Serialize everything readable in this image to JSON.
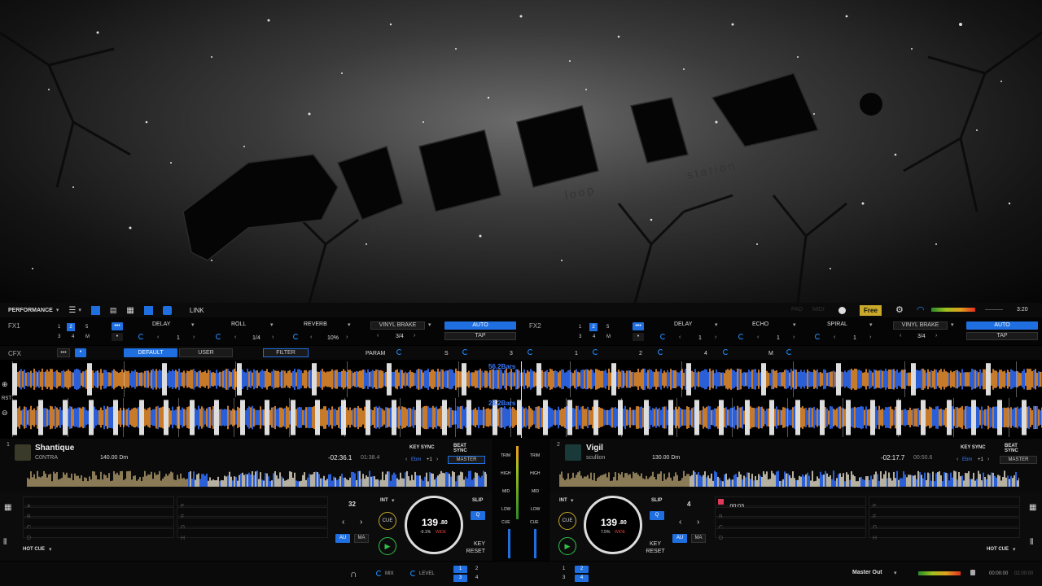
{
  "colors": {
    "accent": "#1f6fe0",
    "wave_blue": "#2b5fd8",
    "wave_orange": "#c77a2a",
    "free_badge": "#caa92a"
  },
  "banner": {
    "logo_word": "AUSY",
    "logo_sub": "Beatbox loop station"
  },
  "topbar": {
    "mode": "PERFORMANCE",
    "link": "LINK",
    "pad": "PAD",
    "midi": "MIDI",
    "free": "Free",
    "time": "3:20"
  },
  "fx1": {
    "label": "FX1",
    "pages": [
      "1",
      "2",
      "5",
      "3",
      "4",
      "M"
    ],
    "slots": [
      {
        "name": "DELAY",
        "value": "1"
      },
      {
        "name": "ROLL",
        "value": "1/4"
      },
      {
        "name": "REVERB",
        "value": "10%"
      }
    ],
    "vinyl_brake": "VINYL BRAKE",
    "vb_value": "3/4",
    "auto": "AUTO",
    "tap": "TAP"
  },
  "fx2": {
    "label": "FX2",
    "pages": [
      "1",
      "2",
      "5",
      "3",
      "4",
      "M"
    ],
    "slots": [
      {
        "name": "DELAY",
        "value": "1"
      },
      {
        "name": "ECHO",
        "value": "1"
      },
      {
        "name": "SPIRAL",
        "value": "1"
      }
    ],
    "vinyl_brake": "VINYL BRAKE",
    "vb_value": "3/4",
    "auto": "AUTO",
    "tap": "TAP"
  },
  "cfx": {
    "label": "CFX",
    "default": "DEFAULT",
    "user": "USER",
    "filter": "FILTER",
    "param": "PARAM",
    "s": "S",
    "n3": "3",
    "n1": "1",
    "n2": "2",
    "n4": "4",
    "m": "M"
  },
  "waveform": {
    "top_bars": "56.2Bars",
    "bottom_bars": "28.2Bars",
    "rst": "RST"
  },
  "deck1": {
    "num": "1",
    "title": "Shantique",
    "artist": "C0NTRA",
    "bpm_key": "140.00 Dm",
    "remain": "-02:36.1",
    "elapsed": "01:38.4",
    "key_sync": "KEY SYNC",
    "beat_sync": "BEAT SYNC",
    "key": "Ebm",
    "key_shift": "+1",
    "master": "MASTER",
    "loop": "32",
    "int": "INT",
    "cue": "CUE",
    "slip": "SLIP",
    "q": "Q",
    "au": "AU",
    "ma": "MA",
    "jog_bpm": "139",
    "jog_dec": ".80",
    "jog_pct": "-0.1%",
    "jog_wide": "WIDE",
    "key_reset": "KEY RESET",
    "hot_cue": "HOT CUE",
    "pads_left": [
      "A",
      "B",
      "C",
      "D"
    ],
    "pads_right": [
      "E",
      "F",
      "G",
      "H"
    ]
  },
  "deck2": {
    "num": "2",
    "title": "Vigil",
    "artist": "scullion",
    "bpm_key": "130.00 Dm",
    "remain": "-02:17.7",
    "elapsed": "00:50.6",
    "key_sync": "KEY SYNC",
    "beat_sync": "BEAT SYNC",
    "key": "Ebm",
    "key_shift": "+1",
    "master": "MASTER",
    "loop": "4",
    "int": "INT",
    "cue": "CUE",
    "slip": "SLIP",
    "q": "Q",
    "au": "AU",
    "ma": "MA",
    "jog_bpm": "139",
    "jog_dec": ".80",
    "jog_pct": "7.5%",
    "jog_wide": "WIDE",
    "key_reset": "KEY RESET",
    "hot_cue": "HOT CUE",
    "pad_a_time": "00:03",
    "pads_left": [
      "A",
      "B",
      "C",
      "D"
    ],
    "pads_right": [
      "E",
      "F",
      "G",
      "H"
    ]
  },
  "mixer": {
    "trim": "TRIM",
    "high": "HIGH",
    "mid": "MID",
    "low": "LOW",
    "cue": "CUE"
  },
  "bottombar": {
    "mix": "MIX",
    "level": "LEVEL",
    "sel": [
      "1",
      "2",
      "3",
      "4"
    ],
    "output": "Master Out",
    "rec_time": "00:00:00",
    "rec_total": "02:00:00"
  }
}
